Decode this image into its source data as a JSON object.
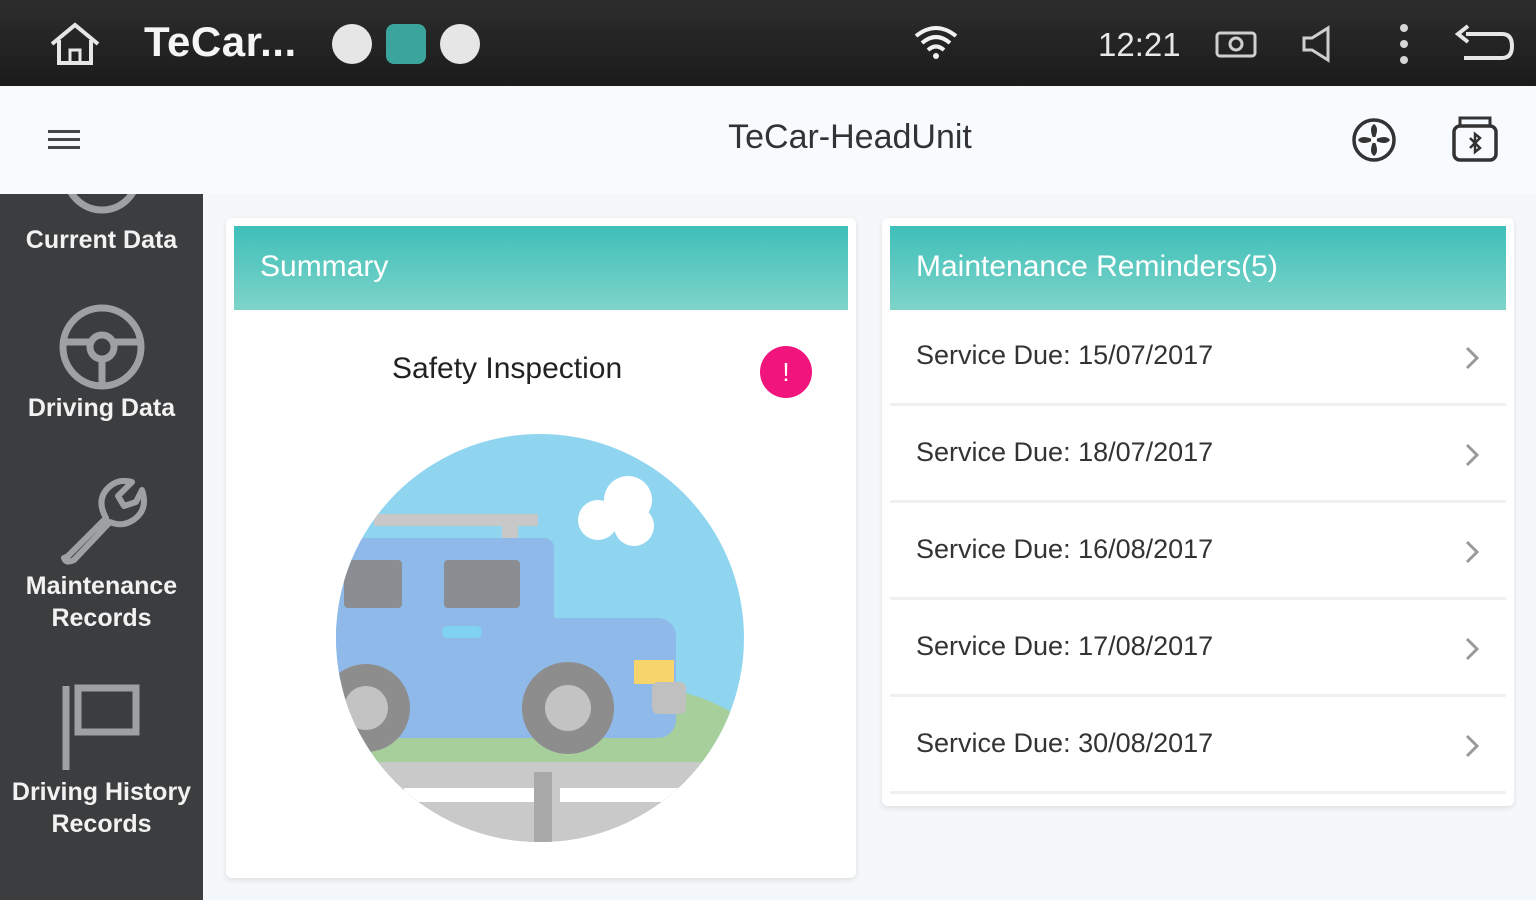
{
  "statusbar": {
    "app_title": "TeCar...",
    "time": "12:21",
    "icons": [
      "home-icon",
      "app-m-icon",
      "app-green-icon",
      "app-m2-icon",
      "wifi-icon",
      "screenshot-icon",
      "volume-icon",
      "more-icon",
      "back-icon"
    ]
  },
  "appbar": {
    "title": "TeCar-HeadUnit",
    "icons": [
      "menu-icon",
      "fan-icon",
      "bluetooth-device-icon"
    ]
  },
  "sidenav": {
    "items": [
      {
        "label": "Current Data",
        "icon": "gauge-icon"
      },
      {
        "label": "Driving Data",
        "icon": "steering-wheel-icon"
      },
      {
        "label": "Maintenance Records",
        "icon": "wrench-icon"
      },
      {
        "label": "Driving History Records",
        "icon": "flag-icon"
      }
    ]
  },
  "summary": {
    "header": "Summary",
    "inspection_title": "Safety Inspection",
    "alert": "!"
  },
  "maintenance": {
    "header": "Maintenance Reminders(5)",
    "items": [
      {
        "label": "Service Due: 15/07/2017"
      },
      {
        "label": "Service Due: 18/07/2017"
      },
      {
        "label": "Service Due: 16/08/2017"
      },
      {
        "label": "Service Due: 17/08/2017"
      },
      {
        "label": "Service Due: 30/08/2017"
      }
    ]
  },
  "colors": {
    "accent_teal": "#3ebfb9",
    "alert_pink": "#f0147c",
    "drawer": "#3b3d3f",
    "statusbar": "#1b1b1b"
  }
}
